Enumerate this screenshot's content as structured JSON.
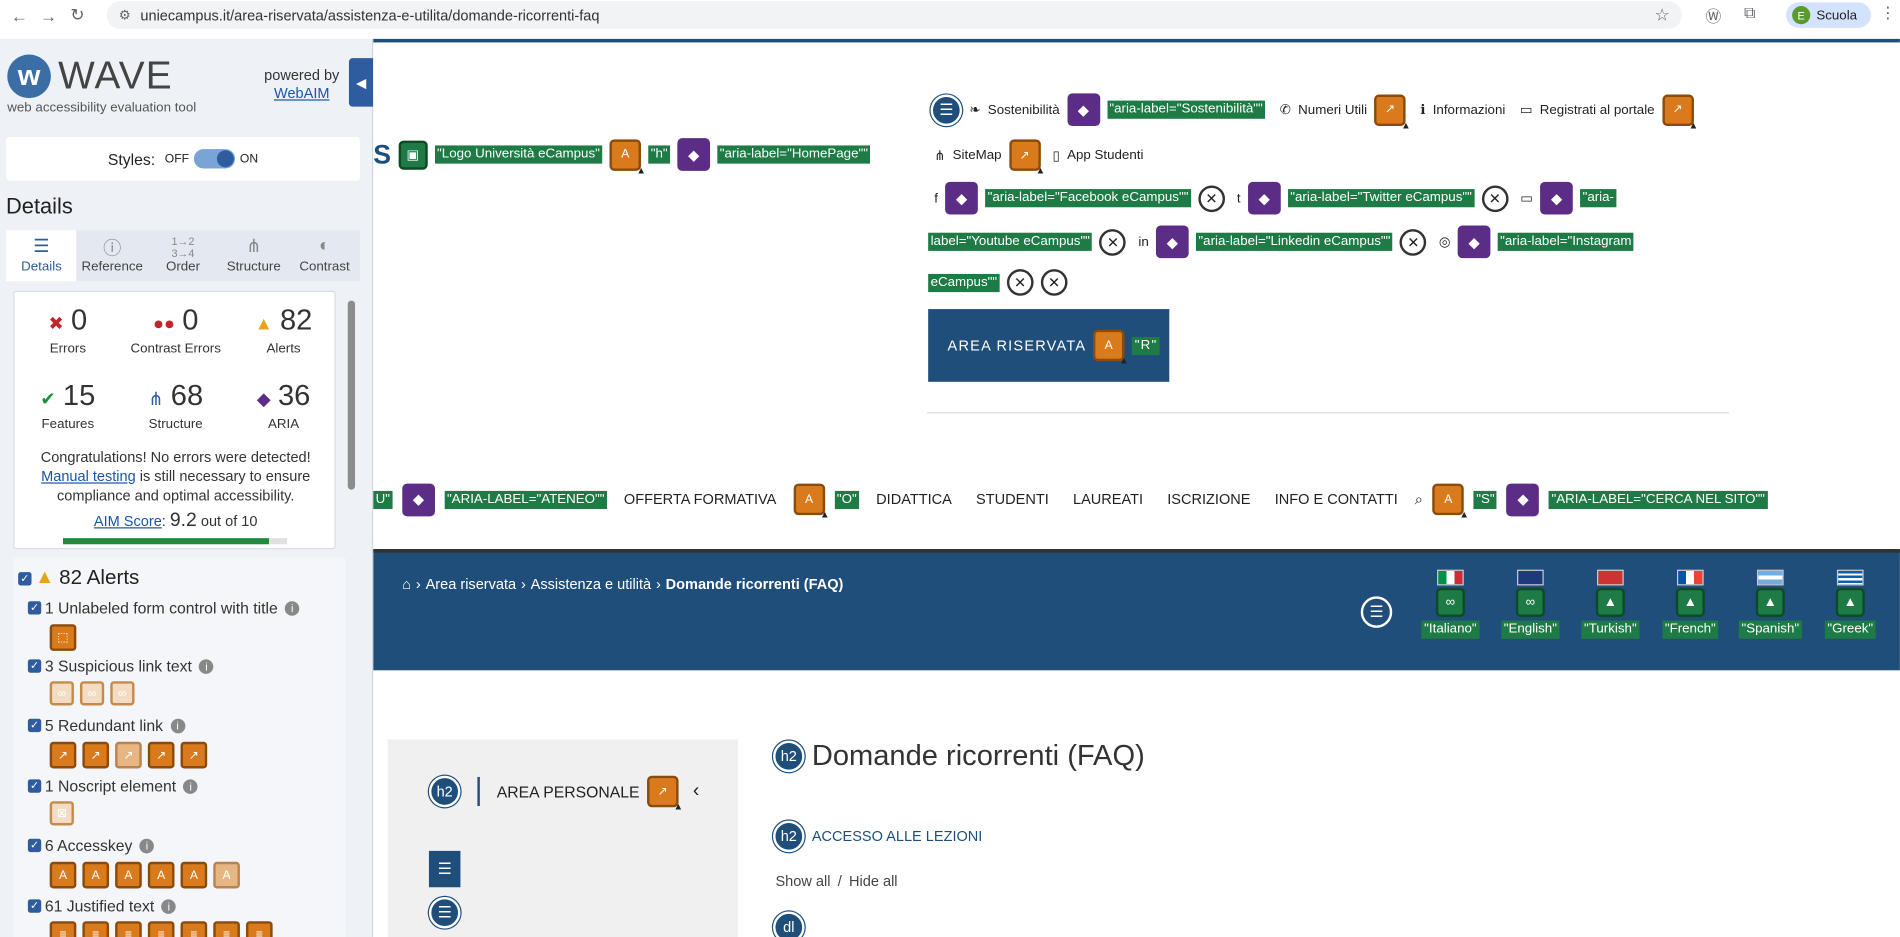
{
  "browser": {
    "url": "uniecampus.it/area-riservata/assistenza-e-utilita/domande-ricorrenti-faq",
    "profile_label": "Scuola",
    "profile_initial": "E"
  },
  "wave": {
    "logo_text": "WAVE",
    "subtitle": "web accessibility evaluation tool",
    "powered_by": "powered by",
    "webaim": "WebAIM",
    "styles_label": "Styles:",
    "off": "OFF",
    "on": "ON",
    "details_heading": "Details",
    "tabs": [
      "Details",
      "Reference",
      "Order",
      "Structure",
      "Contrast"
    ],
    "stats": {
      "errors": {
        "value": "0",
        "label": "Errors"
      },
      "contrast": {
        "value": "0",
        "label": "Contrast Errors"
      },
      "alerts": {
        "value": "82",
        "label": "Alerts"
      },
      "features": {
        "value": "15",
        "label": "Features"
      },
      "structure": {
        "value": "68",
        "label": "Structure"
      },
      "aria": {
        "value": "36",
        "label": "ARIA"
      }
    },
    "congrats": "Congratulations! No errors were detected!",
    "manual_testing": "Manual testing",
    "congrats_rest": "is still necessary to ensure compliance and optimal accessibility.",
    "aim_label": "AIM Score",
    "aim_score": "9.2",
    "aim_out_of": "out of 10",
    "aim_fraction": 0.92,
    "alerts_heading": "82 Alerts",
    "alert_rows": [
      {
        "label": "1 Unlabeled form control with title"
      },
      {
        "label": "3 Suspicious link text"
      },
      {
        "label": "5 Redundant link"
      },
      {
        "label": "1 Noscript element"
      },
      {
        "label": "6 Accesskey"
      },
      {
        "label": "61 Justified text"
      }
    ]
  },
  "site": {
    "logo_label": "\"Logo Università eCampus\"",
    "h_label": "\"h\"",
    "homepage_label": "\"aria-label=\"HomePage\"\"",
    "top_links": {
      "sostenibilita": "Sostenibilità",
      "sostenibilita_aria": "\"aria-label=\"Sostenibilità\"\"",
      "numeri": "Numeri Utili",
      "informazioni": "Informazioni",
      "registrati": "Registrati al portale",
      "sitemap": "SiteMap",
      "app": "App Studenti"
    },
    "social": {
      "facebook": "\"aria-label=\"Facebook eCampus\"\"",
      "twitter": "\"aria-label=\"Twitter eCampus\"\"",
      "youtube_a": "\"aria-",
      "youtube_b": "label=\"Youtube eCampus\"\"",
      "linkedin": "\"aria-label=\"Linkedin eCampus\"\"",
      "instagram_a": "\"aria-label=\"Instagram",
      "instagram_b": "eCampus\"\""
    },
    "area_riservata": "AREA RISERVATA",
    "r_label": "\"R\"",
    "menu": {
      "u_label": "U\"",
      "ateneo": "\"ARIA-LABEL=\"ATENEO\"\"",
      "offerta": "OFFERTA FORMATIVA",
      "o_label": "\"O\"",
      "didattica": "DIDATTICA",
      "studenti": "STUDENTI",
      "laureati": "LAUREATI",
      "iscrizione": "ISCRIZIONE",
      "info": "INFO E CONTATTI",
      "s_label": "\"S\"",
      "cerca": "\"ARIA-LABEL=\"CERCA NEL SITO\"\""
    },
    "breadcrumb": {
      "a": "Area riservata",
      "b": "Assistenza e utilità",
      "c": "Domande ricorrenti (FAQ)"
    },
    "languages": [
      "\"Italiano\"",
      "\"English\"",
      "\"Turkish\"",
      "\"French\"",
      "\"Spanish\"",
      "\"Greek\""
    ],
    "area_personale": "AREA PERSONALE",
    "page_title": "Domande ricorrenti (FAQ)",
    "accesso": "ACCESSO ALLE LEZIONI",
    "show_all": "Show all",
    "hide_all": "Hide all",
    "h2": "h2",
    "dl": "dl"
  }
}
